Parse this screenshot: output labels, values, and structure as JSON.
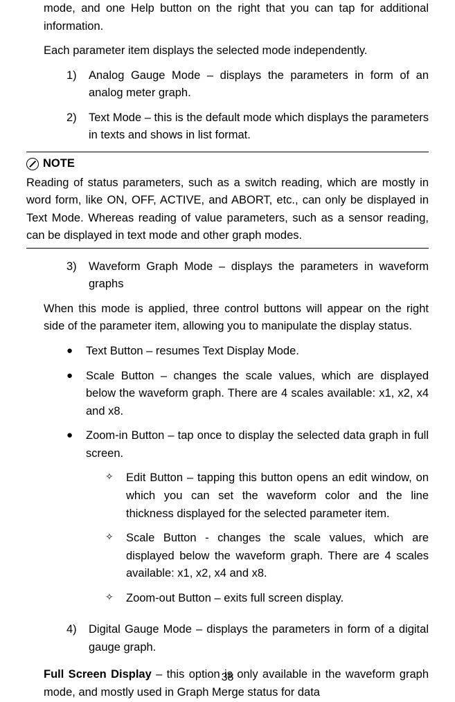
{
  "intro": {
    "p1": "mode, and one Help button on the right that you can tap for additional information.",
    "p2": "Each parameter item displays the selected mode independently."
  },
  "list1": [
    {
      "marker": "1)",
      "text": "Analog Gauge Mode – displays the parameters in form of an analog meter graph."
    },
    {
      "marker": "2)",
      "text": "Text Mode – this is the default mode which displays the parameters in texts and shows in list format."
    }
  ],
  "note": {
    "title": "NOTE",
    "body": "Reading of status parameters, such as a switch reading, which are mostly in word form, like ON, OFF, ACTIVE, and ABORT, etc., can only be displayed in Text Mode. Whereas reading of value parameters, such as a sensor reading, can be displayed in text mode and other graph modes."
  },
  "list2": [
    {
      "marker": "3)",
      "text": "Waveform Graph Mode – displays the parameters in waveform graphs"
    }
  ],
  "after3": "When this mode is applied, three control buttons will appear on the right side of the parameter item, allowing you to manipulate the display status.",
  "bullets": [
    {
      "text": "Text Button – resumes Text Display Mode."
    },
    {
      "text": "Scale Button – changes the scale values, which are displayed below the waveform graph. There are 4 scales available: x1, x2, x4 and x8."
    },
    {
      "text": "Zoom-in Button – tap once to display the selected data graph in full screen."
    }
  ],
  "diamonds": [
    {
      "text": "Edit Button – tapping this button opens an edit window, on which you can set the waveform color and the line thickness displayed for the selected parameter item."
    },
    {
      "text": "Scale Button - changes the scale values, which are displayed below the waveform graph. There are 4 scales available: x1, x2, x4 and x8."
    },
    {
      "text": "Zoom-out Button – exits full screen display."
    }
  ],
  "list3": [
    {
      "marker": "4)",
      "text": "Digital Gauge Mode – displays the parameters in form of a digital gauge graph."
    }
  ],
  "fsd": {
    "bold": "Full Screen Display",
    "rest": " – this option is only available in the waveform graph mode, and mostly used in Graph Merge status for data"
  },
  "pageNumber": "38"
}
